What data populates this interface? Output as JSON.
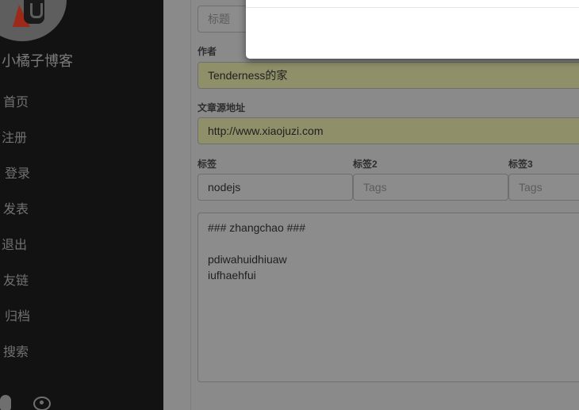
{
  "sidebar": {
    "blog_name": "小橘子博客",
    "nav": [
      "首页",
      "注册",
      "登录",
      "发表",
      "退出",
      "友链",
      "归档",
      "搜索"
    ],
    "social": [
      "qq-icon",
      "weibo-icon"
    ]
  },
  "form": {
    "title": {
      "placeholder": "标题"
    },
    "author": {
      "label": "作者",
      "value": "Tenderness的家"
    },
    "source": {
      "label": "文章源地址",
      "value": "http://www.xiaojuzi.com"
    },
    "tags": [
      {
        "label": "标签",
        "value": "nodejs",
        "placeholder": ""
      },
      {
        "label": "标签2",
        "value": "",
        "placeholder": "Tags"
      },
      {
        "label": "标签3",
        "value": "",
        "placeholder": "Tags"
      }
    ],
    "content_lines": [
      "### zhangchao ###",
      "",
      "pdiwahuidhiuaw",
      "iufhaehfui"
    ]
  },
  "colors": {
    "sidebar_bg": "#121212",
    "overlay_bg": "#8a8a8a",
    "autofill_bg": "#8f8f6a",
    "modal_bg": "#ffffff"
  }
}
